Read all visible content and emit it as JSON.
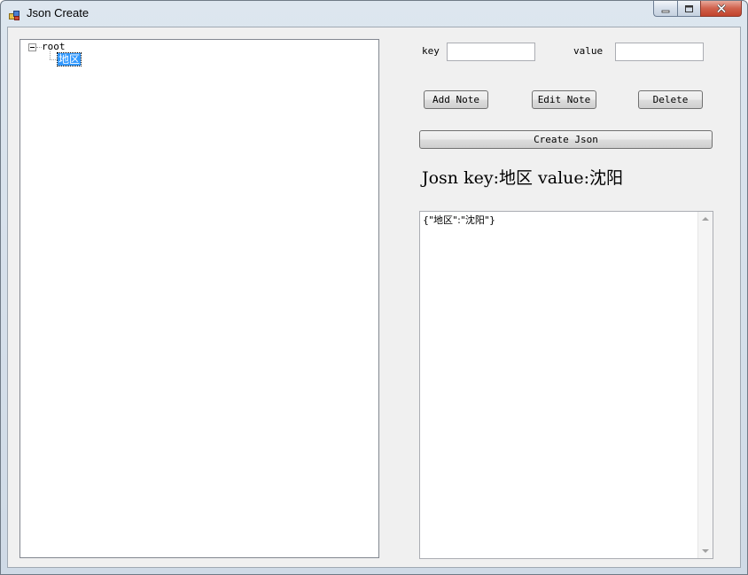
{
  "window": {
    "title": "Json Create"
  },
  "icons": {
    "app": "application-icon",
    "minimize": "minimize-icon",
    "maximize": "maximize-icon",
    "close": "close-icon"
  },
  "tree": {
    "root_label": "root",
    "children": [
      "地区"
    ],
    "selected": "地区"
  },
  "form": {
    "key_label": "key",
    "key_value": "",
    "value_label": "value",
    "value_value": ""
  },
  "buttons": {
    "add_note": "Add Note",
    "edit_note": "Edit Note",
    "delete": "Delete",
    "create_json": "Create Json"
  },
  "info": {
    "text": "Josn key:地区 value:沈阳"
  },
  "output": {
    "text": "{\"地区\":\"沈阳\"}"
  },
  "colors": {
    "selection": "#3399ff",
    "close_button": "#c1432c",
    "window_frame": "#cfdae6",
    "client_background": "#f0f0f0"
  }
}
